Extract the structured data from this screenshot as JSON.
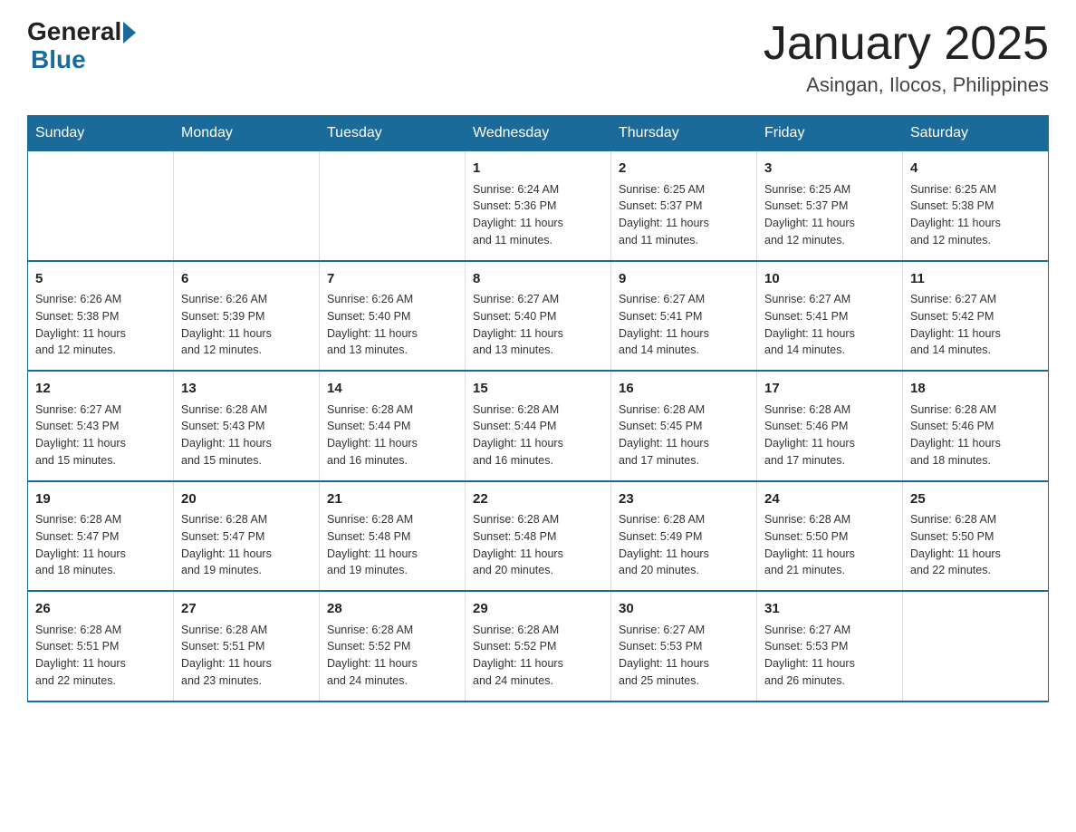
{
  "header": {
    "logo": {
      "general": "General",
      "blue": "Blue"
    },
    "title": "January 2025",
    "location": "Asingan, Ilocos, Philippines"
  },
  "days_of_week": [
    "Sunday",
    "Monday",
    "Tuesday",
    "Wednesday",
    "Thursday",
    "Friday",
    "Saturday"
  ],
  "weeks": [
    [
      {
        "day": "",
        "info": ""
      },
      {
        "day": "",
        "info": ""
      },
      {
        "day": "",
        "info": ""
      },
      {
        "day": "1",
        "info": "Sunrise: 6:24 AM\nSunset: 5:36 PM\nDaylight: 11 hours\nand 11 minutes."
      },
      {
        "day": "2",
        "info": "Sunrise: 6:25 AM\nSunset: 5:37 PM\nDaylight: 11 hours\nand 11 minutes."
      },
      {
        "day": "3",
        "info": "Sunrise: 6:25 AM\nSunset: 5:37 PM\nDaylight: 11 hours\nand 12 minutes."
      },
      {
        "day": "4",
        "info": "Sunrise: 6:25 AM\nSunset: 5:38 PM\nDaylight: 11 hours\nand 12 minutes."
      }
    ],
    [
      {
        "day": "5",
        "info": "Sunrise: 6:26 AM\nSunset: 5:38 PM\nDaylight: 11 hours\nand 12 minutes."
      },
      {
        "day": "6",
        "info": "Sunrise: 6:26 AM\nSunset: 5:39 PM\nDaylight: 11 hours\nand 12 minutes."
      },
      {
        "day": "7",
        "info": "Sunrise: 6:26 AM\nSunset: 5:40 PM\nDaylight: 11 hours\nand 13 minutes."
      },
      {
        "day": "8",
        "info": "Sunrise: 6:27 AM\nSunset: 5:40 PM\nDaylight: 11 hours\nand 13 minutes."
      },
      {
        "day": "9",
        "info": "Sunrise: 6:27 AM\nSunset: 5:41 PM\nDaylight: 11 hours\nand 14 minutes."
      },
      {
        "day": "10",
        "info": "Sunrise: 6:27 AM\nSunset: 5:41 PM\nDaylight: 11 hours\nand 14 minutes."
      },
      {
        "day": "11",
        "info": "Sunrise: 6:27 AM\nSunset: 5:42 PM\nDaylight: 11 hours\nand 14 minutes."
      }
    ],
    [
      {
        "day": "12",
        "info": "Sunrise: 6:27 AM\nSunset: 5:43 PM\nDaylight: 11 hours\nand 15 minutes."
      },
      {
        "day": "13",
        "info": "Sunrise: 6:28 AM\nSunset: 5:43 PM\nDaylight: 11 hours\nand 15 minutes."
      },
      {
        "day": "14",
        "info": "Sunrise: 6:28 AM\nSunset: 5:44 PM\nDaylight: 11 hours\nand 16 minutes."
      },
      {
        "day": "15",
        "info": "Sunrise: 6:28 AM\nSunset: 5:44 PM\nDaylight: 11 hours\nand 16 minutes."
      },
      {
        "day": "16",
        "info": "Sunrise: 6:28 AM\nSunset: 5:45 PM\nDaylight: 11 hours\nand 17 minutes."
      },
      {
        "day": "17",
        "info": "Sunrise: 6:28 AM\nSunset: 5:46 PM\nDaylight: 11 hours\nand 17 minutes."
      },
      {
        "day": "18",
        "info": "Sunrise: 6:28 AM\nSunset: 5:46 PM\nDaylight: 11 hours\nand 18 minutes."
      }
    ],
    [
      {
        "day": "19",
        "info": "Sunrise: 6:28 AM\nSunset: 5:47 PM\nDaylight: 11 hours\nand 18 minutes."
      },
      {
        "day": "20",
        "info": "Sunrise: 6:28 AM\nSunset: 5:47 PM\nDaylight: 11 hours\nand 19 minutes."
      },
      {
        "day": "21",
        "info": "Sunrise: 6:28 AM\nSunset: 5:48 PM\nDaylight: 11 hours\nand 19 minutes."
      },
      {
        "day": "22",
        "info": "Sunrise: 6:28 AM\nSunset: 5:48 PM\nDaylight: 11 hours\nand 20 minutes."
      },
      {
        "day": "23",
        "info": "Sunrise: 6:28 AM\nSunset: 5:49 PM\nDaylight: 11 hours\nand 20 minutes."
      },
      {
        "day": "24",
        "info": "Sunrise: 6:28 AM\nSunset: 5:50 PM\nDaylight: 11 hours\nand 21 minutes."
      },
      {
        "day": "25",
        "info": "Sunrise: 6:28 AM\nSunset: 5:50 PM\nDaylight: 11 hours\nand 22 minutes."
      }
    ],
    [
      {
        "day": "26",
        "info": "Sunrise: 6:28 AM\nSunset: 5:51 PM\nDaylight: 11 hours\nand 22 minutes."
      },
      {
        "day": "27",
        "info": "Sunrise: 6:28 AM\nSunset: 5:51 PM\nDaylight: 11 hours\nand 23 minutes."
      },
      {
        "day": "28",
        "info": "Sunrise: 6:28 AM\nSunset: 5:52 PM\nDaylight: 11 hours\nand 24 minutes."
      },
      {
        "day": "29",
        "info": "Sunrise: 6:28 AM\nSunset: 5:52 PM\nDaylight: 11 hours\nand 24 minutes."
      },
      {
        "day": "30",
        "info": "Sunrise: 6:27 AM\nSunset: 5:53 PM\nDaylight: 11 hours\nand 25 minutes."
      },
      {
        "day": "31",
        "info": "Sunrise: 6:27 AM\nSunset: 5:53 PM\nDaylight: 11 hours\nand 26 minutes."
      },
      {
        "day": "",
        "info": ""
      }
    ]
  ]
}
